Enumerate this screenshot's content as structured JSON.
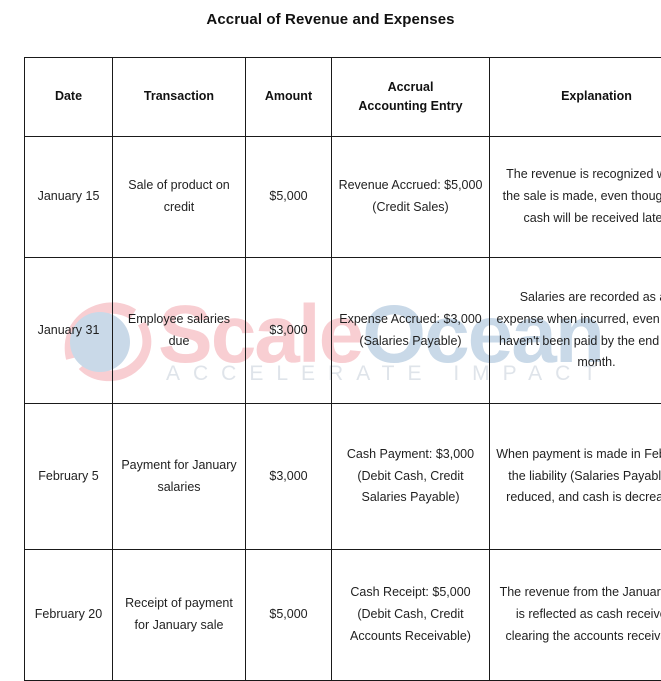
{
  "document": {
    "title": "Accrual of Revenue and Expenses"
  },
  "watermark": {
    "brand_part_1": "Scale",
    "brand_part_2": "Ocean",
    "tagline": "ACCELERATE IMPACT",
    "logo_icon": "scaleocean-logo-icon",
    "colors": {
      "brand_pink": "#f8ced2",
      "brand_blue": "#c9d9e8",
      "tagline_gray": "#dfe4ea"
    }
  },
  "table": {
    "columns": [
      "Date",
      "Transaction",
      "Amount",
      "Accrual\nAccounting Entry",
      "Explanation"
    ],
    "column_headers": {
      "date": "Date",
      "transaction": "Transaction",
      "amount": "Amount",
      "entry_line_1": "Accrual",
      "entry_line_2": "Accounting Entry",
      "explanation": "Explanation"
    },
    "rows": [
      {
        "date": "January 15",
        "transaction": "Sale of product on credit",
        "amount": "$5,000",
        "entry": "Revenue Accrued: $5,000 (Credit Sales)",
        "explanation": "The revenue is recognized when the sale is made, even though the cash will be received later."
      },
      {
        "date": "January 31",
        "transaction": "Employee salaries due",
        "amount": "$3,000",
        "entry": "Expense Accrued: $3,000 (Salaries Payable)",
        "explanation": "Salaries are recorded as an expense when incurred, even if they haven't been paid by the end of the month."
      },
      {
        "date": "February 5",
        "transaction": "Payment for January salaries",
        "amount": "$3,000",
        "entry": "Cash Payment: $3,000 (Debit Cash, Credit Salaries Payable)",
        "explanation": "When payment is made in February, the liability (Salaries Payable) is reduced, and cash is decreased."
      },
      {
        "date": "February 20",
        "transaction": "Receipt of payment for January sale",
        "amount": "$5,000",
        "entry": "Cash Receipt: $5,000 (Debit Cash, Credit Accounts Receivable)",
        "explanation": "The revenue from the January sale is reflected as cash received, clearing the accounts receivable."
      }
    ]
  }
}
